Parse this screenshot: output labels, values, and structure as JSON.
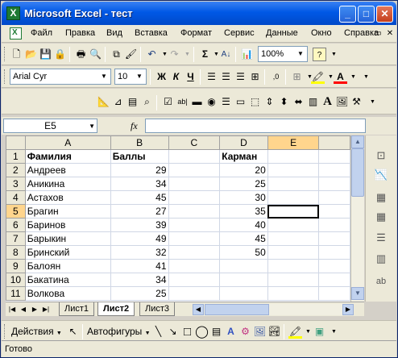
{
  "window": {
    "title": "Microsoft Excel - тест",
    "app_icon": "excel-icon"
  },
  "menu": {
    "items": [
      "Файл",
      "Правка",
      "Вид",
      "Вставка",
      "Формат",
      "Сервис",
      "Данные",
      "Окно",
      "Справка"
    ]
  },
  "standard_toolbar": {
    "sum_symbol": "Σ",
    "zoom": "100%",
    "help": "?"
  },
  "format_toolbar": {
    "font": "Arial Cyr",
    "size": "10",
    "bold": "Ж",
    "italic": "К",
    "underline": "Ч",
    "font_color_letter": "A"
  },
  "formula_bar": {
    "cell_ref": "E5",
    "fx_label": "fx",
    "content": ""
  },
  "grid": {
    "columns": [
      "A",
      "B",
      "C",
      "D",
      "E"
    ],
    "rows": [
      {
        "n": "1",
        "cells": [
          "Фамилия",
          "Баллы",
          "",
          "Карман",
          ""
        ]
      },
      {
        "n": "2",
        "cells": [
          "Андреев",
          "29",
          "",
          "20",
          ""
        ]
      },
      {
        "n": "3",
        "cells": [
          "Аникина",
          "34",
          "",
          "25",
          ""
        ]
      },
      {
        "n": "4",
        "cells": [
          "Астахов",
          "45",
          "",
          "30",
          ""
        ]
      },
      {
        "n": "5",
        "cells": [
          "Брагин",
          "27",
          "",
          "35",
          ""
        ]
      },
      {
        "n": "6",
        "cells": [
          "Баринов",
          "39",
          "",
          "40",
          ""
        ]
      },
      {
        "n": "7",
        "cells": [
          "Барыкин",
          "49",
          "",
          "45",
          ""
        ]
      },
      {
        "n": "8",
        "cells": [
          "Бринский",
          "32",
          "",
          "50",
          ""
        ]
      },
      {
        "n": "9",
        "cells": [
          "Балоян",
          "41",
          "",
          "",
          ""
        ]
      },
      {
        "n": "10",
        "cells": [
          "Бакатина",
          "34",
          "",
          "",
          ""
        ]
      },
      {
        "n": "11",
        "cells": [
          "Волкова",
          "25",
          "",
          "",
          ""
        ]
      }
    ],
    "active_cell": "E5"
  },
  "sheets": {
    "tabs": [
      "Лист1",
      "Лист2",
      "Лист3"
    ],
    "active": "Лист2"
  },
  "drawing_toolbar": {
    "actions": "Действия",
    "autoshapes": "Автофигуры"
  },
  "status": {
    "text": "Готово"
  }
}
